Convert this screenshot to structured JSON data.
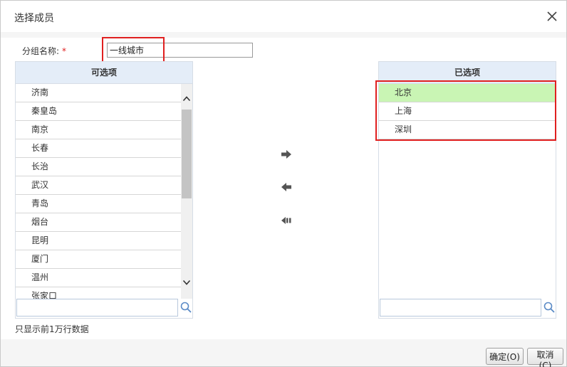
{
  "dialog": {
    "title": "选择成员",
    "close_icon": "close-icon"
  },
  "group": {
    "label": "分组名称:",
    "required_mark": "*",
    "value": "一线城市"
  },
  "available": {
    "header": "可选项",
    "items": [
      "济南",
      "秦皇岛",
      "南京",
      "长春",
      "长治",
      "武汉",
      "青岛",
      "烟台",
      "昆明",
      "厦门",
      "温州",
      "张家口"
    ],
    "search_placeholder": ""
  },
  "selected": {
    "header": "已选项",
    "items": [
      "北京",
      "上海",
      "深圳"
    ],
    "search_placeholder": ""
  },
  "transfer": {
    "add_icon": "arrow-right-icon",
    "remove_icon": "arrow-left-icon",
    "remove_all_icon": "arrow-double-left-icon"
  },
  "footnote": "只显示前1万行数据",
  "buttons": {
    "ok": "确定(O)",
    "cancel": "取消(C)"
  },
  "colors": {
    "selected_row": "#c9f5b4",
    "panel_header": "#e4edf8",
    "highlight": "#e02020"
  }
}
